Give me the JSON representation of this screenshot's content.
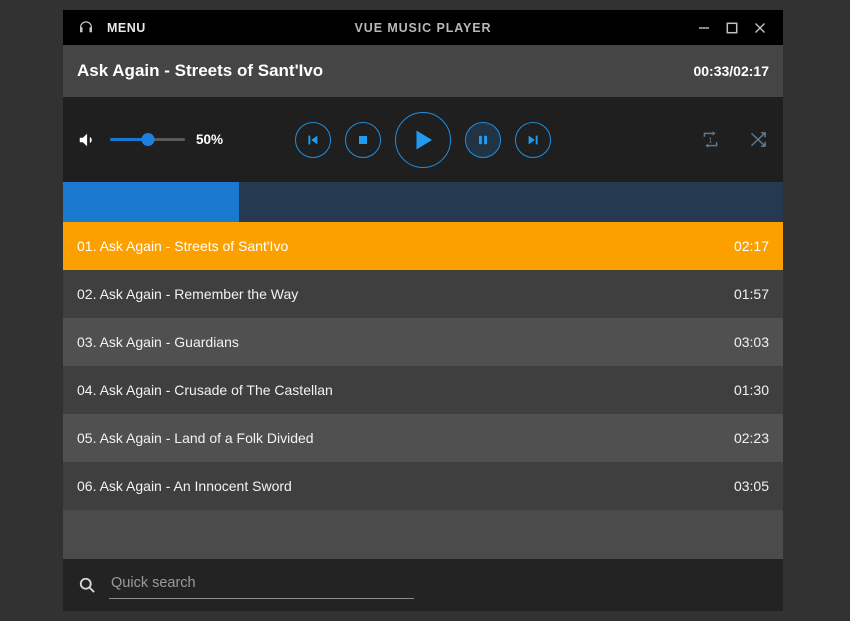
{
  "titlebar": {
    "menu_label": "MENU",
    "menu_icon": "headphone-icon",
    "app_title": "VUE MUSIC PLAYER",
    "minimize_icon": "minimize-icon",
    "maximize_icon": "maximize-icon",
    "close_icon": "close-icon"
  },
  "now_playing": {
    "track_title": "Ask Again - Streets of Sant'Ivo",
    "time_display": "00:33/02:17",
    "elapsed": "00:33",
    "duration": "02:17"
  },
  "controls": {
    "volume_icon": "speaker-volume-icon",
    "volume_percent_label": "50%",
    "volume_value": 50,
    "transport": [
      {
        "name": "previous-track-button",
        "icon": "skip-previous-icon",
        "size": "sm",
        "state": "normal"
      },
      {
        "name": "stop-button",
        "icon": "stop-icon",
        "size": "sm",
        "state": "normal"
      },
      {
        "name": "play-button",
        "icon": "play-icon",
        "size": "lg",
        "state": "normal"
      },
      {
        "name": "pause-button",
        "icon": "pause-icon",
        "size": "sm",
        "state": "hover"
      },
      {
        "name": "next-track-button",
        "icon": "skip-next-icon",
        "size": "sm",
        "state": "normal"
      }
    ],
    "repeat_icon": "repeat-one-icon",
    "shuffle_icon": "shuffle-icon",
    "accent_color": "#1f8fe0",
    "inactive_mode_color": "#5d7a91"
  },
  "progress": {
    "percent": 24.4,
    "fill_color": "#1c79d0",
    "track_color": "#253a51"
  },
  "playlist": {
    "active_index": 0,
    "active_color": "#fca000",
    "tracks": [
      {
        "label": "01. Ask Again - Streets of Sant'Ivo",
        "duration": "02:17"
      },
      {
        "label": "02. Ask Again - Remember the Way",
        "duration": "01:57"
      },
      {
        "label": "03. Ask Again - Guardians",
        "duration": "03:03"
      },
      {
        "label": "04. Ask Again - Crusade of The Castellan",
        "duration": "01:30"
      },
      {
        "label": "05. Ask Again - Land of a Folk Divided",
        "duration": "02:23"
      },
      {
        "label": "06. Ask Again - An Innocent Sword",
        "duration": "03:05"
      }
    ]
  },
  "search": {
    "icon": "search-icon",
    "placeholder": "Quick search",
    "value": ""
  }
}
